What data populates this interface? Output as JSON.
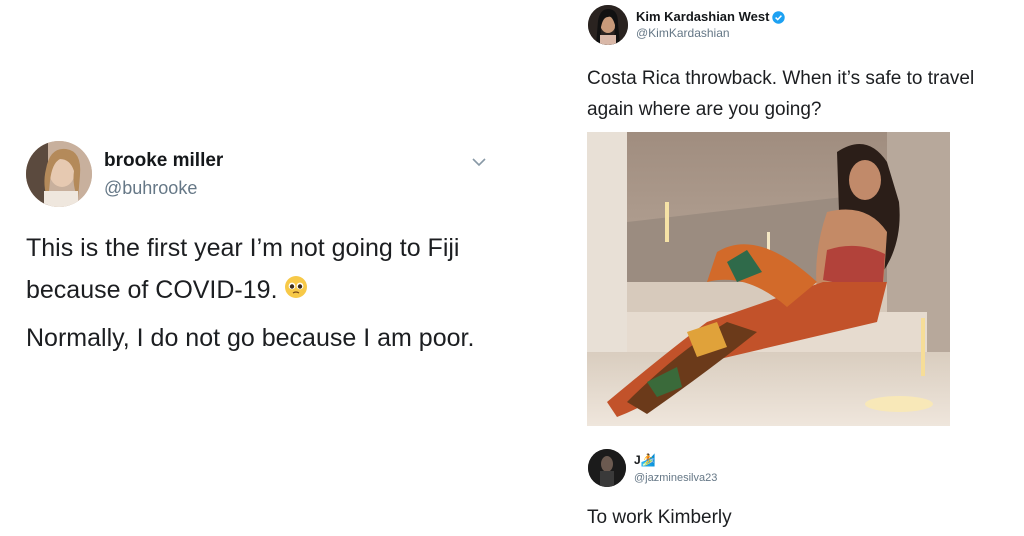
{
  "left_tweet": {
    "author_name": "brooke miller",
    "author_handle": "@buhrooke",
    "text_line1": "This is the first year I’m not going to Fiji because of COVID-19.",
    "text_line2": "Normally, I do not go because I am poor.",
    "emoji_name": "pleading-face-emoji"
  },
  "right_tweet": {
    "author_name": "Kim Kardashian West",
    "author_handle": "@KimKardashian",
    "text": "Costa Rica throwback. When it’s safe to travel again where are you going?",
    "reply": {
      "author_name": "J🏄",
      "author_handle": "@jazminesilva23",
      "text": "To work Kimberly"
    }
  },
  "colors": {
    "handle_gray": "#657786",
    "verified_blue": "#1da1f2"
  }
}
